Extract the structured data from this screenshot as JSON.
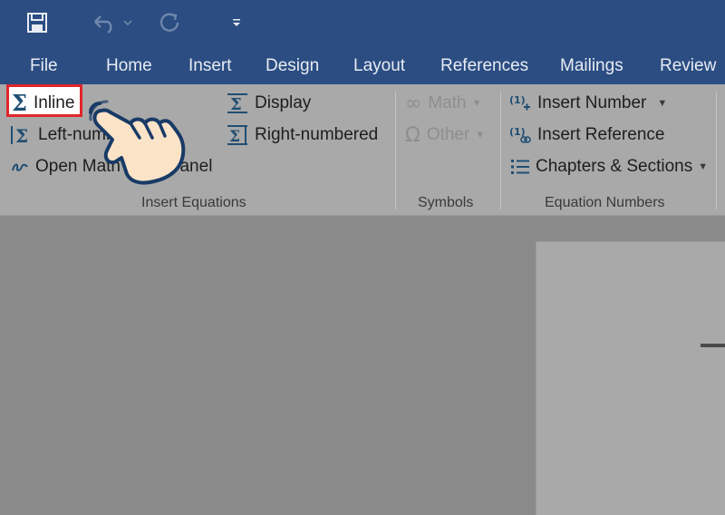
{
  "quick_access": {
    "save_icon": "save-icon",
    "undo_icon": "undo-icon",
    "redo_icon": "redo-icon",
    "customize_icon": "customize-toolbar-icon"
  },
  "tabs": [
    "File",
    "Home",
    "Insert",
    "Design",
    "Layout",
    "References",
    "Mailings",
    "Review"
  ],
  "ribbon": {
    "insert_equations": {
      "inline": "Inline",
      "left_numbered": "Left-numbered",
      "open_math_panel": "Open Math Input Panel",
      "display": "Display",
      "right_numbered": "Right-numbered",
      "label": "Insert Equations"
    },
    "symbols": {
      "math": "Math",
      "other": "Other",
      "label": "Symbols"
    },
    "equation_numbers": {
      "insert_number": "Insert Number",
      "insert_reference": "Insert Reference",
      "chapters_sections": "Chapters & Sections",
      "label": "Equation Numbers"
    }
  },
  "colors": {
    "title_bar": "#2b4d82",
    "ribbon_bg": "#a9a9a9",
    "highlight_border": "#e0262a",
    "icon_blue": "#1f4e73"
  }
}
